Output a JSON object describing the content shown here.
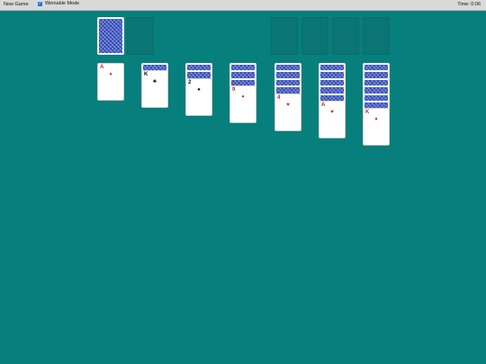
{
  "toolbar": {
    "new_game_label": "New Game",
    "winnable_label": "Winnable Mode",
    "winnable_checked": true,
    "timer_text": "Time: 0:06"
  },
  "tableau": [
    {
      "face_down": 0,
      "face_up": {
        "rank": "A",
        "suit": "♦",
        "color": "red"
      }
    },
    {
      "face_down": 1,
      "face_up": {
        "rank": "K",
        "suit": "♣",
        "color": "black"
      }
    },
    {
      "face_down": 2,
      "face_up": {
        "rank": "2",
        "suit": "♠",
        "color": "black"
      }
    },
    {
      "face_down": 3,
      "face_up": {
        "rank": "9",
        "suit": "♦",
        "color": "red"
      }
    },
    {
      "face_down": 4,
      "face_up": {
        "rank": "4",
        "suit": "♥",
        "color": "red"
      }
    },
    {
      "face_down": 5,
      "face_up": {
        "rank": "A",
        "suit": "♥",
        "color": "red"
      }
    },
    {
      "face_down": 6,
      "face_up": {
        "rank": "K",
        "suit": "♦",
        "color": "red"
      }
    }
  ],
  "stock": {
    "has_cards": true
  },
  "waste": {
    "empty": true
  },
  "foundations": [
    {
      "empty": true
    },
    {
      "empty": true
    },
    {
      "empty": true
    },
    {
      "empty": true
    }
  ],
  "colors": {
    "felt": "#067f7d",
    "card_back": "#2a44b4",
    "red_suit": "#d22020"
  }
}
